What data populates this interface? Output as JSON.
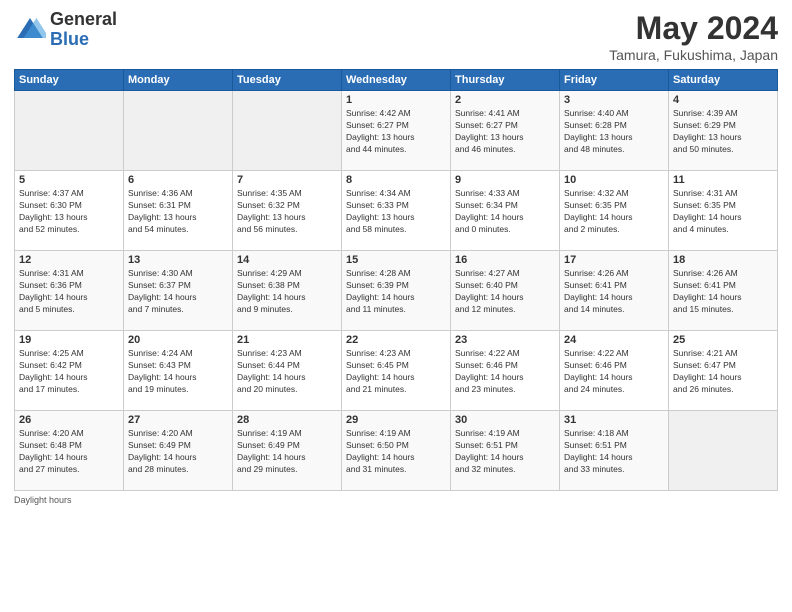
{
  "header": {
    "logo_general": "General",
    "logo_blue": "Blue",
    "month_title": "May 2024",
    "location": "Tamura, Fukushima, Japan"
  },
  "calendar": {
    "days_of_week": [
      "Sunday",
      "Monday",
      "Tuesday",
      "Wednesday",
      "Thursday",
      "Friday",
      "Saturday"
    ],
    "weeks": [
      [
        {
          "day": "",
          "info": ""
        },
        {
          "day": "",
          "info": ""
        },
        {
          "day": "",
          "info": ""
        },
        {
          "day": "1",
          "info": "Sunrise: 4:42 AM\nSunset: 6:27 PM\nDaylight: 13 hours\nand 44 minutes."
        },
        {
          "day": "2",
          "info": "Sunrise: 4:41 AM\nSunset: 6:27 PM\nDaylight: 13 hours\nand 46 minutes."
        },
        {
          "day": "3",
          "info": "Sunrise: 4:40 AM\nSunset: 6:28 PM\nDaylight: 13 hours\nand 48 minutes."
        },
        {
          "day": "4",
          "info": "Sunrise: 4:39 AM\nSunset: 6:29 PM\nDaylight: 13 hours\nand 50 minutes."
        }
      ],
      [
        {
          "day": "5",
          "info": "Sunrise: 4:37 AM\nSunset: 6:30 PM\nDaylight: 13 hours\nand 52 minutes."
        },
        {
          "day": "6",
          "info": "Sunrise: 4:36 AM\nSunset: 6:31 PM\nDaylight: 13 hours\nand 54 minutes."
        },
        {
          "day": "7",
          "info": "Sunrise: 4:35 AM\nSunset: 6:32 PM\nDaylight: 13 hours\nand 56 minutes."
        },
        {
          "day": "8",
          "info": "Sunrise: 4:34 AM\nSunset: 6:33 PM\nDaylight: 13 hours\nand 58 minutes."
        },
        {
          "day": "9",
          "info": "Sunrise: 4:33 AM\nSunset: 6:34 PM\nDaylight: 14 hours\nand 0 minutes."
        },
        {
          "day": "10",
          "info": "Sunrise: 4:32 AM\nSunset: 6:35 PM\nDaylight: 14 hours\nand 2 minutes."
        },
        {
          "day": "11",
          "info": "Sunrise: 4:31 AM\nSunset: 6:35 PM\nDaylight: 14 hours\nand 4 minutes."
        }
      ],
      [
        {
          "day": "12",
          "info": "Sunrise: 4:31 AM\nSunset: 6:36 PM\nDaylight: 14 hours\nand 5 minutes."
        },
        {
          "day": "13",
          "info": "Sunrise: 4:30 AM\nSunset: 6:37 PM\nDaylight: 14 hours\nand 7 minutes."
        },
        {
          "day": "14",
          "info": "Sunrise: 4:29 AM\nSunset: 6:38 PM\nDaylight: 14 hours\nand 9 minutes."
        },
        {
          "day": "15",
          "info": "Sunrise: 4:28 AM\nSunset: 6:39 PM\nDaylight: 14 hours\nand 11 minutes."
        },
        {
          "day": "16",
          "info": "Sunrise: 4:27 AM\nSunset: 6:40 PM\nDaylight: 14 hours\nand 12 minutes."
        },
        {
          "day": "17",
          "info": "Sunrise: 4:26 AM\nSunset: 6:41 PM\nDaylight: 14 hours\nand 14 minutes."
        },
        {
          "day": "18",
          "info": "Sunrise: 4:26 AM\nSunset: 6:41 PM\nDaylight: 14 hours\nand 15 minutes."
        }
      ],
      [
        {
          "day": "19",
          "info": "Sunrise: 4:25 AM\nSunset: 6:42 PM\nDaylight: 14 hours\nand 17 minutes."
        },
        {
          "day": "20",
          "info": "Sunrise: 4:24 AM\nSunset: 6:43 PM\nDaylight: 14 hours\nand 19 minutes."
        },
        {
          "day": "21",
          "info": "Sunrise: 4:23 AM\nSunset: 6:44 PM\nDaylight: 14 hours\nand 20 minutes."
        },
        {
          "day": "22",
          "info": "Sunrise: 4:23 AM\nSunset: 6:45 PM\nDaylight: 14 hours\nand 21 minutes."
        },
        {
          "day": "23",
          "info": "Sunrise: 4:22 AM\nSunset: 6:46 PM\nDaylight: 14 hours\nand 23 minutes."
        },
        {
          "day": "24",
          "info": "Sunrise: 4:22 AM\nSunset: 6:46 PM\nDaylight: 14 hours\nand 24 minutes."
        },
        {
          "day": "25",
          "info": "Sunrise: 4:21 AM\nSunset: 6:47 PM\nDaylight: 14 hours\nand 26 minutes."
        }
      ],
      [
        {
          "day": "26",
          "info": "Sunrise: 4:20 AM\nSunset: 6:48 PM\nDaylight: 14 hours\nand 27 minutes."
        },
        {
          "day": "27",
          "info": "Sunrise: 4:20 AM\nSunset: 6:49 PM\nDaylight: 14 hours\nand 28 minutes."
        },
        {
          "day": "28",
          "info": "Sunrise: 4:19 AM\nSunset: 6:49 PM\nDaylight: 14 hours\nand 29 minutes."
        },
        {
          "day": "29",
          "info": "Sunrise: 4:19 AM\nSunset: 6:50 PM\nDaylight: 14 hours\nand 31 minutes."
        },
        {
          "day": "30",
          "info": "Sunrise: 4:19 AM\nSunset: 6:51 PM\nDaylight: 14 hours\nand 32 minutes."
        },
        {
          "day": "31",
          "info": "Sunrise: 4:18 AM\nSunset: 6:51 PM\nDaylight: 14 hours\nand 33 minutes."
        },
        {
          "day": "",
          "info": ""
        }
      ]
    ]
  },
  "footer": {
    "daylight_label": "Daylight hours"
  }
}
